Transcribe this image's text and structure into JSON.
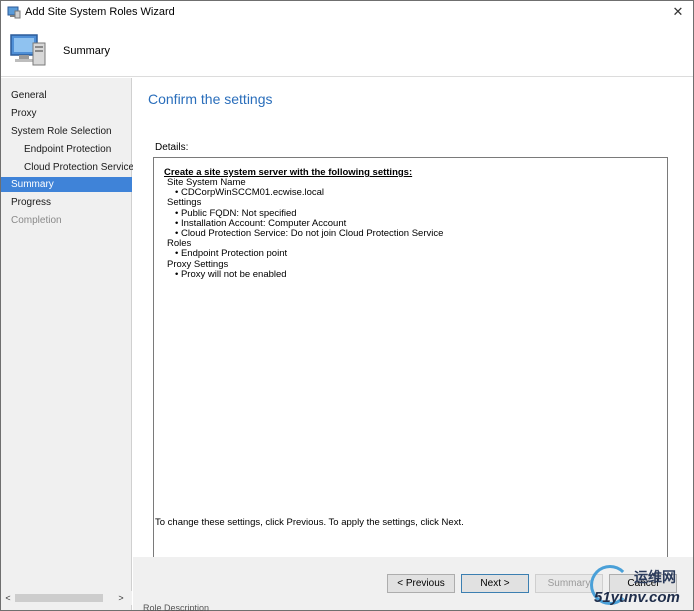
{
  "window": {
    "title": "Add Site System Roles Wizard",
    "close_glyph": "✕"
  },
  "header": {
    "title": "Summary"
  },
  "nav": {
    "items": [
      {
        "label": "General",
        "state": "normal"
      },
      {
        "label": "Proxy",
        "state": "normal"
      },
      {
        "label": "System Role Selection",
        "state": "normal"
      },
      {
        "label": "Endpoint Protection",
        "state": "normal",
        "sub": true
      },
      {
        "label": "Cloud Protection Service",
        "state": "normal",
        "sub": true
      },
      {
        "label": "Summary",
        "state": "active"
      },
      {
        "label": "Progress",
        "state": "normal"
      },
      {
        "label": "Completion",
        "state": "disabled"
      }
    ],
    "scroll_left": "<",
    "scroll_right": ">"
  },
  "main": {
    "heading": "Confirm the settings",
    "details_label": "Details:",
    "details_heading": "Create a site system server with the following settings:",
    "details_lines": [
      {
        "text": "Site System Name",
        "level": 1
      },
      {
        "text": "• CDCorpWinSCCM01.ecwise.local",
        "level": 2
      },
      {
        "text": "Settings",
        "level": 1
      },
      {
        "text": "• Public FQDN: Not specified",
        "level": 2
      },
      {
        "text": "• Installation Account: Computer Account",
        "level": 2
      },
      {
        "text": "• Cloud Protection Service: Do not join Cloud Protection Service",
        "level": 2
      },
      {
        "text": "Roles",
        "level": 1
      },
      {
        "text": "• Endpoint Protection point",
        "level": 2
      },
      {
        "text": "Proxy Settings",
        "level": 1
      },
      {
        "text": "• Proxy will not be enabled",
        "level": 2
      }
    ],
    "info_text": "To change these settings, click Previous. To apply the settings, click Next."
  },
  "footer": {
    "previous_label": "< Previous",
    "next_label": "Next >",
    "summary_label": "Summary",
    "cancel_label": "Cancel"
  },
  "partial_text": "Role Description",
  "watermark": {
    "top": "运维网",
    "bottom": "51yunv.com"
  },
  "colors": {
    "accent": "#3f83d8",
    "heading": "#2a6ebb"
  }
}
